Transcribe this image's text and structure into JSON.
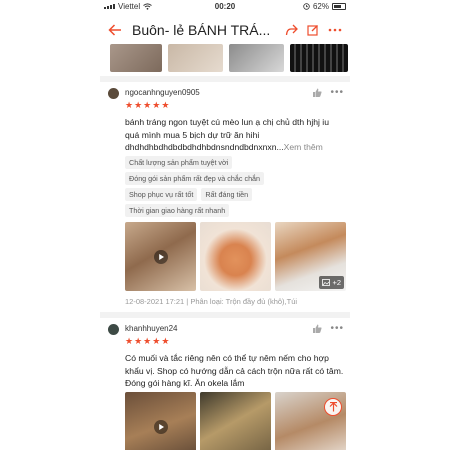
{
  "status_bar": {
    "carrier": "Viettel",
    "time": "00:20",
    "battery": "62%"
  },
  "header": {
    "title": "Buôn- lẻ BÁNH TRÁ...",
    "icons": [
      "back-arrow-icon",
      "share-icon",
      "edit-icon",
      "more-icon"
    ],
    "accent": "#ee4d2d"
  },
  "reviews": [
    {
      "username": "ngocanhnguyen0905",
      "rating": 5,
      "text": "bánh tráng ngon tuyệt cú mèo lun ạ chị chủ dth hjhj iu quá mình mua 5 bịch dự trữ ăn hihi dhdhdhbdhdbdbdhdhbdnsndndbdnxnxn...",
      "see_more": "Xem thêm",
      "tags": [
        [
          "Chất lượng sản phẩm tuyệt vời"
        ],
        [
          "Đóng gói sản phẩm rất đẹp và chắc chắn"
        ],
        [
          "Shop phục vụ rất tốt",
          "Rất đáng tiền"
        ],
        [
          "Thời gian giao hàng rất nhanh"
        ]
      ],
      "extra_media": "+2",
      "meta": "12-08-2021 17:21 | Phân loại: Trộn đầy đủ (khô),Túi"
    },
    {
      "username": "khanhhuyen24",
      "rating": 5,
      "text": "Có muối và tắc riêng nên có thể tự nêm nếm cho hợp khẩu vị. Shop có hướng dẫn cả cách trộn nữa rất có tâm. Đóng gói hàng kĩ. Ăn okela lắm"
    }
  ]
}
